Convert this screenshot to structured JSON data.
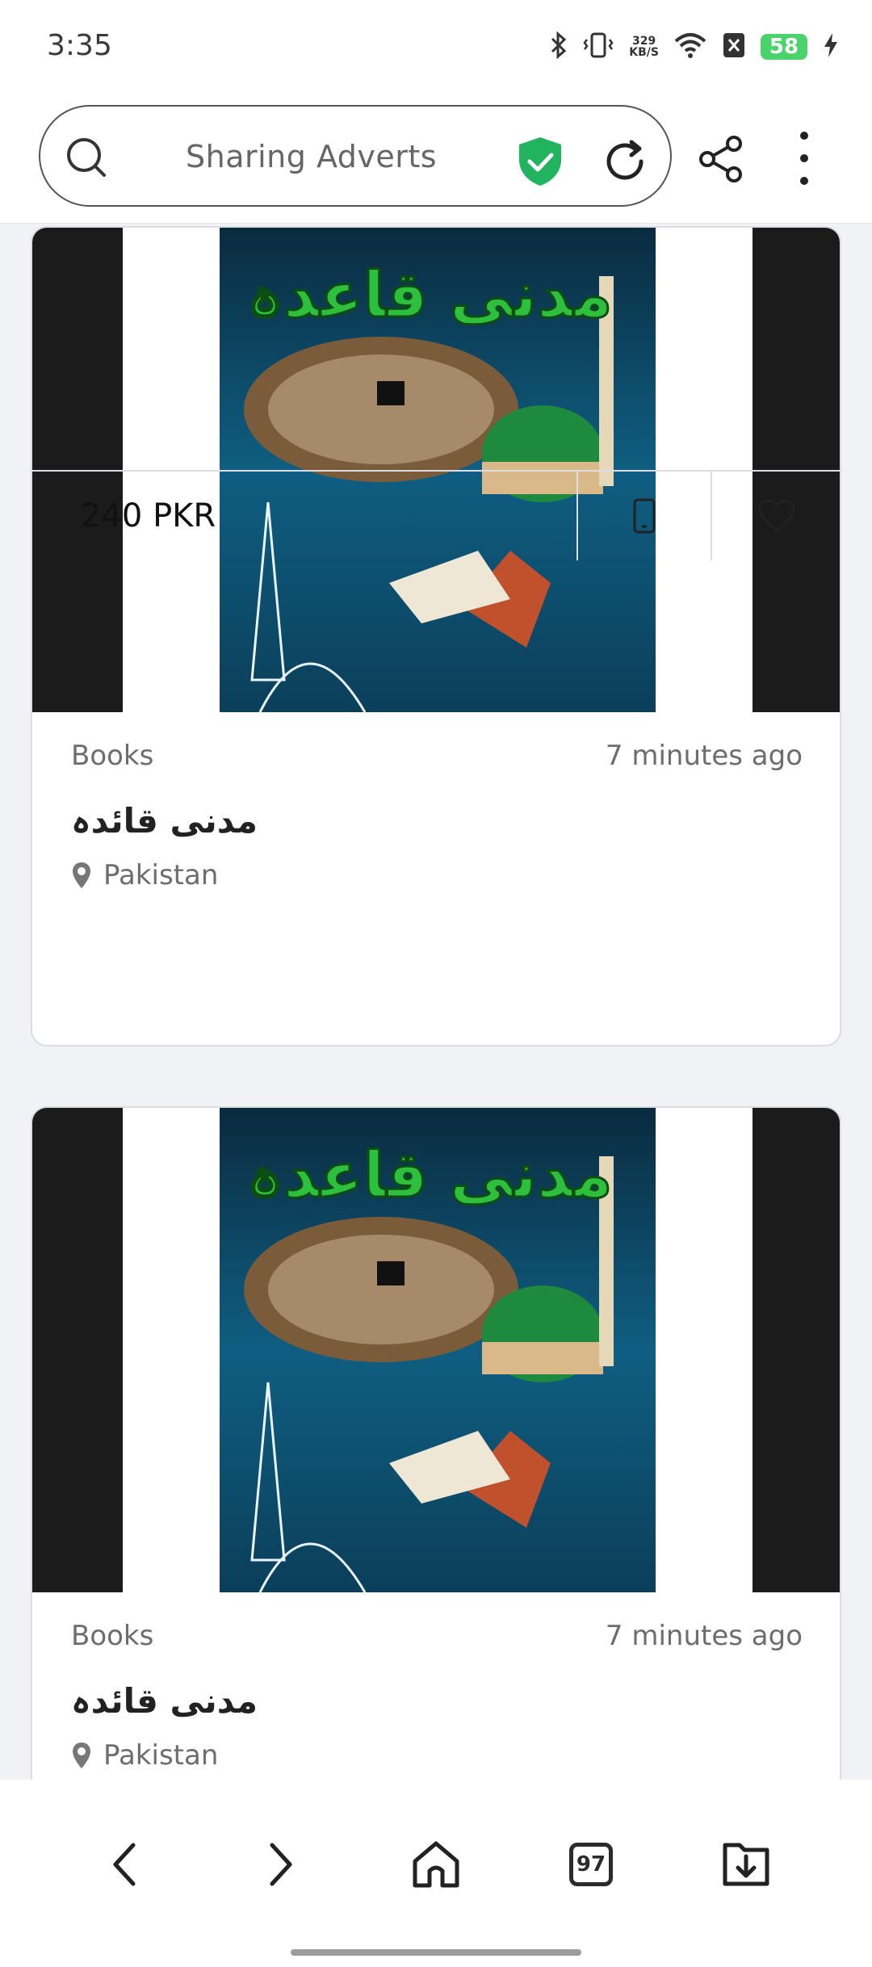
{
  "status_bar": {
    "time": "3:35",
    "net_speed_value": "329",
    "net_speed_unit": "KB/S",
    "battery": "58"
  },
  "browser": {
    "url_text": "Sharing Adverts"
  },
  "listings": [
    {
      "category": "Books",
      "time_ago": "7 minutes ago",
      "title": "مدنی قائدہ",
      "location": "Pakistan",
      "price": "240 PKR",
      "cover_title": "مدنی قاعدہ"
    },
    {
      "category": "Books",
      "time_ago": "7 minutes ago",
      "title": "مدنی قائدہ",
      "location": "Pakistan",
      "cover_title": "مدنی قاعدہ"
    }
  ],
  "bottom_nav": {
    "tab_count": "97"
  },
  "colors": {
    "shield_green": "#22b35f",
    "battery_green": "#4ad36b",
    "cover_blue": "#0f5e82"
  }
}
